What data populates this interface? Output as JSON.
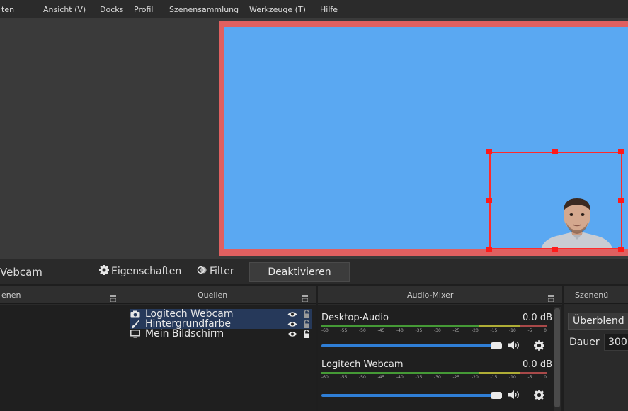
{
  "menu": {
    "items": [
      "ten",
      "Ansicht (V)",
      "Docks",
      "Profil",
      "Szenensammlung",
      "Werkzeuge (T)",
      "Hilfe"
    ]
  },
  "toolbar": {
    "source_name": "Vebcam",
    "properties_label": "Eigenschaften",
    "filter_label": "Filter",
    "deactivate_label": "Deaktivieren"
  },
  "docks": {
    "scenes": {
      "title": "enen"
    },
    "sources": {
      "title": "Quellen",
      "items": [
        {
          "label": "Logitech Webcam",
          "icon": "camera-icon",
          "visible": true,
          "locked": false,
          "selected": true
        },
        {
          "label": "Hintergrundfarbe",
          "icon": "brush-icon",
          "visible": true,
          "locked": false,
          "selected": true
        },
        {
          "label": "Mein Bildschirm",
          "icon": "monitor-icon",
          "visible": true,
          "locked": false,
          "selected": false
        }
      ]
    },
    "mixer": {
      "title": "Audio-Mixer",
      "channels": [
        {
          "name": "Desktop-Audio",
          "db": "0.0 dB"
        },
        {
          "name": "Logitech Webcam",
          "db": "0.0 dB"
        }
      ],
      "ticks": [
        "-60",
        "-55",
        "-50",
        "-45",
        "-40",
        "-35",
        "-30",
        "-25",
        "-20",
        "-15",
        "-10",
        "-5",
        "0"
      ]
    },
    "transitions": {
      "title": "Szenenü",
      "selected": "Überblend",
      "duration_label": "Dauer",
      "duration_value": "300"
    }
  },
  "colors": {
    "accent": "#2f7ed6",
    "preview_background": "#5aa8f2",
    "preview_frame": "#e06060",
    "selection": "#ff2a2a"
  }
}
